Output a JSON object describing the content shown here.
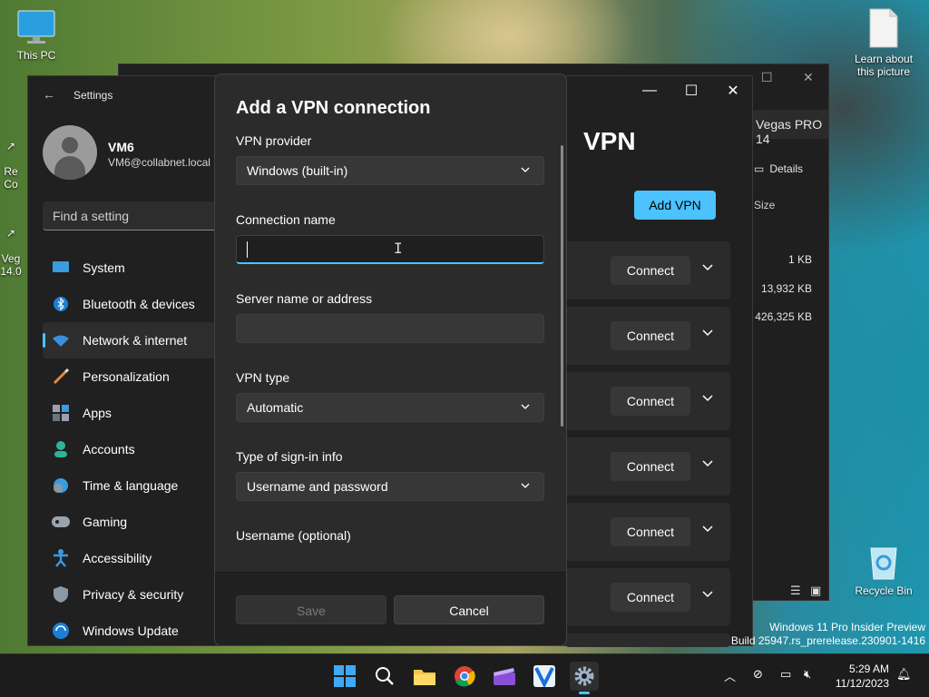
{
  "desktop": {
    "this_pc": "This PC",
    "learn": "Learn about this picture",
    "recycle": "Recycle Bin",
    "partial1": "Re\nCo",
    "partial2": "Veg\n14.0"
  },
  "explorer": {
    "tab": "Vegas PRO 14",
    "details": "Details",
    "size_header": "Size",
    "sizes": [
      "1 KB",
      "13,932 KB",
      "426,325 KB"
    ]
  },
  "settings": {
    "title": "Settings",
    "user_name": "VM6",
    "user_email": "VM6@collabnet.local",
    "search_placeholder": "Find a setting",
    "nav": [
      {
        "label": "System",
        "icon": "system-icon"
      },
      {
        "label": "Bluetooth & devices",
        "icon": "bluetooth-icon"
      },
      {
        "label": "Network & internet",
        "icon": "wifi-icon"
      },
      {
        "label": "Personalization",
        "icon": "brush-icon"
      },
      {
        "label": "Apps",
        "icon": "apps-icon"
      },
      {
        "label": "Accounts",
        "icon": "accounts-icon"
      },
      {
        "label": "Time & language",
        "icon": "clock-globe-icon"
      },
      {
        "label": "Gaming",
        "icon": "gamepad-icon"
      },
      {
        "label": "Accessibility",
        "icon": "accessibility-icon"
      },
      {
        "label": "Privacy & security",
        "icon": "shield-icon"
      },
      {
        "label": "Windows Update",
        "icon": "update-icon"
      }
    ],
    "active_nav": "Network & internet",
    "page_title": "VPN",
    "add_vpn": "Add VPN",
    "connect_label": "Connect"
  },
  "dialog": {
    "title": "Add a VPN connection",
    "provider_label": "VPN provider",
    "provider_value": "Windows (built-in)",
    "conn_name_label": "Connection name",
    "conn_name_value": "",
    "server_label": "Server name or address",
    "server_value": "",
    "type_label": "VPN type",
    "type_value": "Automatic",
    "signin_label": "Type of sign-in info",
    "signin_value": "Username and password",
    "username_label": "Username (optional)",
    "save": "Save",
    "cancel": "Cancel"
  },
  "watermark": {
    "line1": "Windows 11 Pro Insider Preview",
    "line2": "Build 25947.rs_prerelease.230901-1416"
  },
  "taskbar": {
    "time": "5:29 AM",
    "date": "11/12/2023"
  },
  "colors": {
    "accent": "#4cc2ff"
  }
}
